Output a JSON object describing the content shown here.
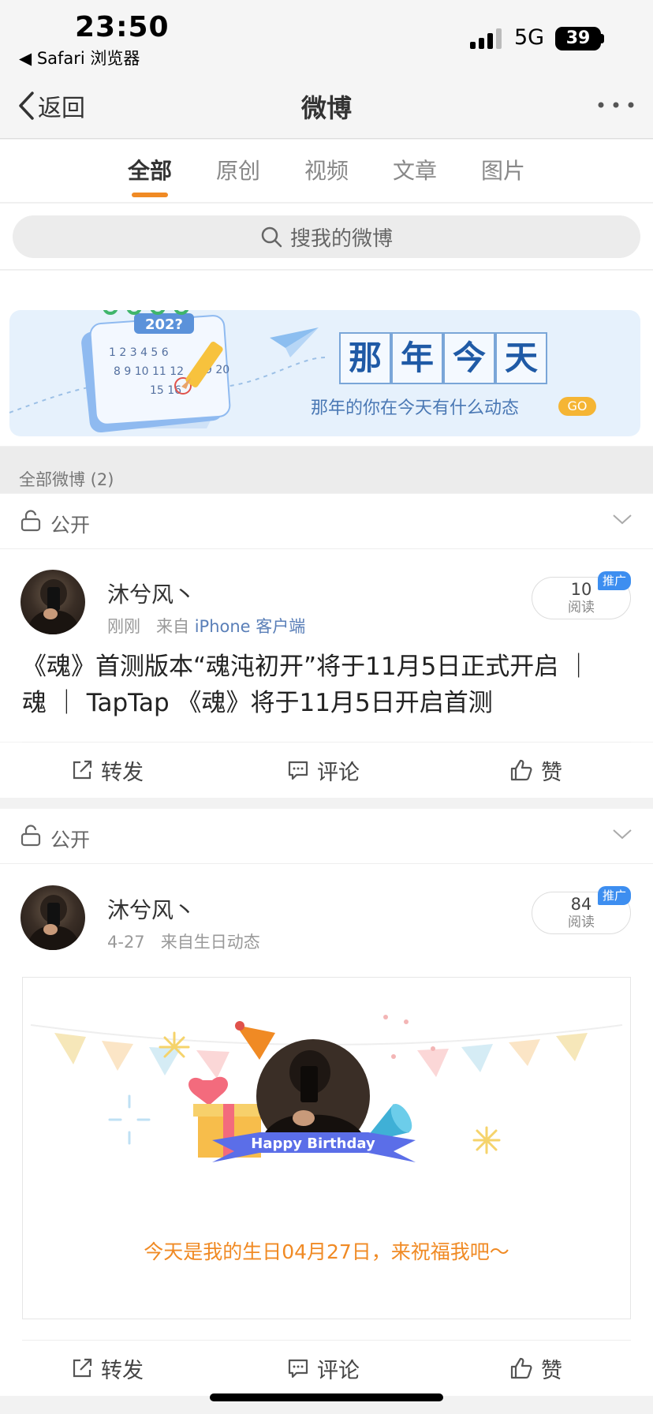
{
  "status_bar": {
    "time": "23:50",
    "back_app": "◀ Safari 浏览器",
    "network": "5G",
    "battery": "39"
  },
  "nav": {
    "back_label": "返回",
    "title": "微博"
  },
  "tabs": [
    {
      "label": "全部",
      "active": true
    },
    {
      "label": "原创",
      "active": false
    },
    {
      "label": "视频",
      "active": false
    },
    {
      "label": "文章",
      "active": false
    },
    {
      "label": "图片",
      "active": false
    }
  ],
  "search": {
    "placeholder": "搜我的微博"
  },
  "banner": {
    "calendar_year": "202?",
    "title_chars": [
      "那",
      "年",
      "今",
      "天"
    ],
    "subtitle": "那年的你在今天有什么动态",
    "go_label": "GO"
  },
  "section": {
    "label": "全部微博 (2)"
  },
  "posts": [
    {
      "privacy": "公开",
      "username": "沐兮风丶",
      "time": "刚刚",
      "source_prefix": "来自",
      "source": "iPhone 客户端",
      "read_count": "10",
      "read_label": "阅读",
      "promo_label": "推广",
      "text_line1": "《魂》首测版本“魂沌初开”将于11月5日正式开启 ｜",
      "text_line2": "魂 ｜ TapTap 《魂》将于11月5日开启首测",
      "actions": {
        "repost": "转发",
        "comment": "评论",
        "like": "赞"
      }
    },
    {
      "privacy": "公开",
      "username": "沐兮风丶",
      "time": "4-27",
      "source_prefix": "来自",
      "source": "生日动态",
      "read_count": "84",
      "read_label": "阅读",
      "promo_label": "推广",
      "birthday_ribbon": "Happy Birthday",
      "birthday_text": "今天是我的生日04月27日，来祝福我吧～",
      "actions": {
        "repost": "转发",
        "comment": "评论",
        "like": "赞"
      }
    }
  ],
  "colors": {
    "accent": "#f08a24",
    "link": "#5a7fb8",
    "promo": "#3d8ef0",
    "banner_bg": "#e6f1fc"
  },
  "icons": [
    "chevron-left-icon",
    "more-icon",
    "search-icon",
    "lock-open-icon",
    "chevron-down-icon",
    "share-icon",
    "comment-icon",
    "thumbs-up-icon",
    "signal-icon"
  ]
}
